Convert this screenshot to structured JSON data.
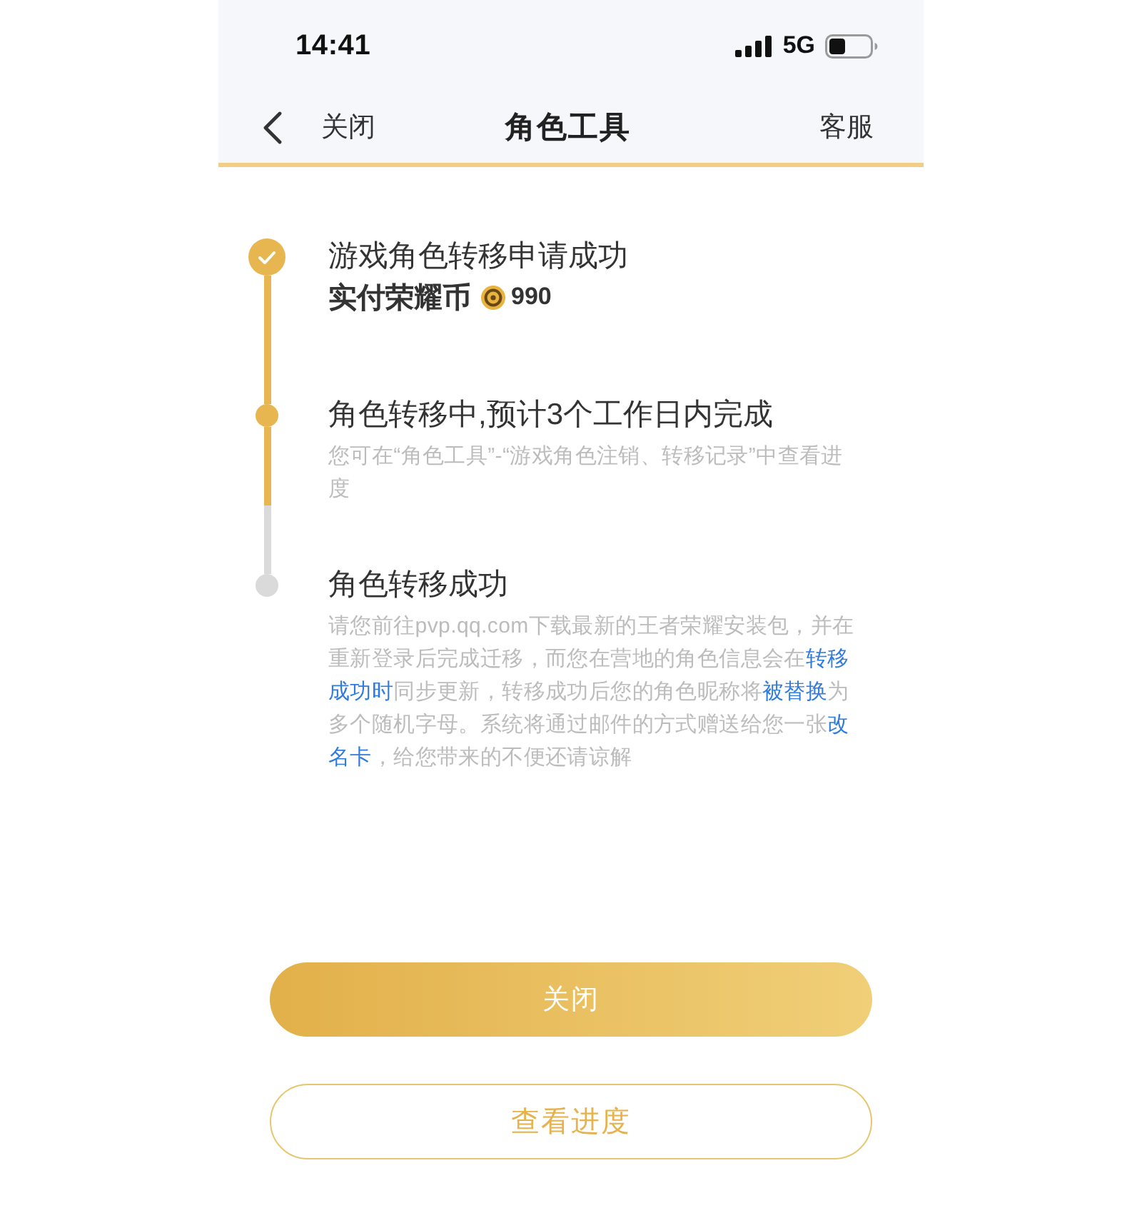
{
  "status_bar": {
    "time": "14:41",
    "network": "5G"
  },
  "nav": {
    "back": "关闭",
    "title": "角色工具",
    "action": "客服"
  },
  "steps": [
    {
      "kind": "done",
      "title": "游戏角色转移申请成功",
      "payment": {
        "label": "实付荣耀币",
        "amount": "990"
      }
    },
    {
      "kind": "active",
      "title": "角色转移中,预计3个工作日内完成",
      "description": [
        {
          "text": "您可在“角色工具”-“游戏角色注销、转移记录”中查看进度",
          "highlight": false
        }
      ]
    },
    {
      "kind": "pending",
      "title": "角色转移成功",
      "description": [
        {
          "text": "请您前往pvp.qq.com下载最新的王者荣耀安装包，并在重新登录后完成迁移，而您在营地的角色信息会在",
          "highlight": false
        },
        {
          "text": "转移成功时",
          "highlight": true
        },
        {
          "text": "同步更新，转移成功后您的角色昵称将",
          "highlight": false
        },
        {
          "text": "被替换",
          "highlight": true
        },
        {
          "text": "为多个随机字母。系统将通过邮件的方式赠送给您一张",
          "highlight": false
        },
        {
          "text": "改名卡",
          "highlight": true
        },
        {
          "text": "，给您带来的不便还请谅解",
          "highlight": false
        }
      ]
    }
  ],
  "buttons": [
    {
      "kind": "primary",
      "label": "关闭"
    },
    {
      "kind": "secondary",
      "label": "查看进度"
    }
  ]
}
